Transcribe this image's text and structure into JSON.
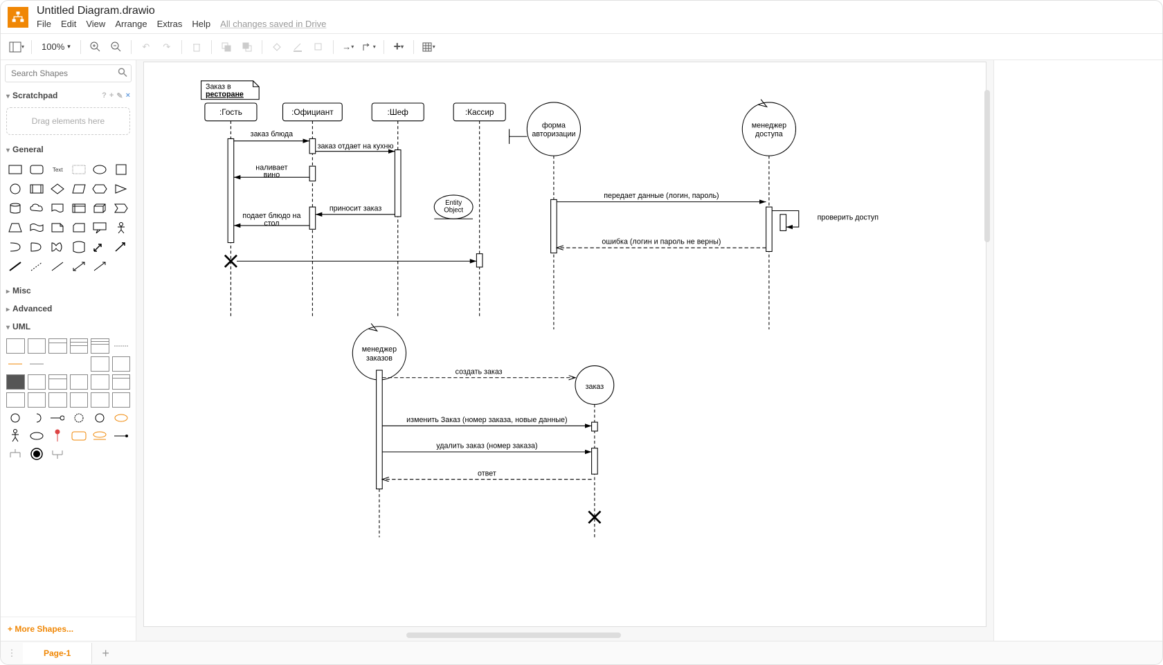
{
  "doc": {
    "title": "Untitled Diagram.drawio"
  },
  "menu": {
    "file": "File",
    "edit": "Edit",
    "view": "View",
    "arrange": "Arrange",
    "extras": "Extras",
    "help": "Help",
    "save_status": "All changes saved in Drive"
  },
  "toolbar": {
    "zoom": "100%"
  },
  "sidebar": {
    "search_placeholder": "Search Shapes",
    "scratchpad": {
      "title": "Scratchpad",
      "hint": "Drag elements here"
    },
    "general": "General",
    "misc": "Misc",
    "advanced": "Advanced",
    "uml": "UML",
    "more_shapes": "+ More Shapes..."
  },
  "footer": {
    "page1": "Page-1"
  },
  "diagram": {
    "note_title": "Заказ в ресторане",
    "lifelines": {
      "guest": ":Гость",
      "waiter": ":Официант",
      "chef": ":Шеф",
      "cashier": ":Кассир"
    },
    "messages": {
      "order_dish": "заказ блюда",
      "to_kitchen": "заказ отдает на кухню",
      "pour_wine": "наливает вино",
      "brings_order": "приносит заказ",
      "serve_dish": "подает блюдо на стол"
    },
    "entity_object": "Entity Object",
    "auth": {
      "form": "форма авторизации",
      "manager": "менеджер доступа",
      "send": "передает данные  (логин, пароль)",
      "check": "проверить доступ",
      "error": "ошибка (логин и пароль не верны)"
    },
    "orders": {
      "manager": "менеджер заказов",
      "order": "заказ",
      "create": "создать заказ",
      "edit": "изменить Заказ (номер заказа, новые данные)",
      "delete": "удалить заказ (номер заказа)",
      "reply": "ответ"
    }
  }
}
